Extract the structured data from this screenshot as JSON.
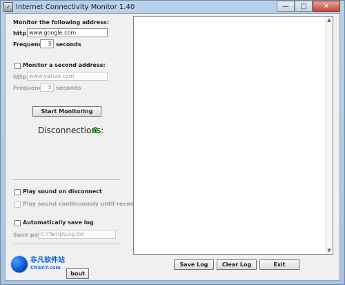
{
  "window": {
    "title": "Internet Connectivity Monitor 1.40",
    "controls": {
      "minimize": "—",
      "maximize": "□",
      "close": "✕"
    }
  },
  "monitor": {
    "primary": {
      "label": "Monitor the following address:",
      "prefix": "http://",
      "address": "www.google.com",
      "frequency_label": "Frequency:",
      "frequency_value": "5",
      "frequency_unit": "seconds"
    },
    "secondary": {
      "enabled": false,
      "label": "Monitor a second address:",
      "prefix": "http://",
      "address": "www.yahoo.com",
      "frequency_label": "Frequency:",
      "frequency_value": "5",
      "frequency_unit": "seconds"
    }
  },
  "actions": {
    "start_label": "Start Monitoring"
  },
  "status": {
    "disconnections_label": "Disconnections:",
    "disconnections_value": "0"
  },
  "options": {
    "play_sound_label": "Play sound on disconnect",
    "play_sound_continuous_label": "Play sound continuously until reconnected",
    "auto_save_log_label": "Automatically save log",
    "save_path_label": "Save path:",
    "save_path_value": "C:\\Temp\\Log.txt"
  },
  "log_buttons": {
    "save_log": "Save Log",
    "clear_log": "Clear Log",
    "exit": "Exit",
    "about_partial": "bout"
  },
  "watermark": {
    "cn": "非凡软件站",
    "en": "CRSKY.com"
  },
  "colors": {
    "success_green": "#18b018"
  }
}
